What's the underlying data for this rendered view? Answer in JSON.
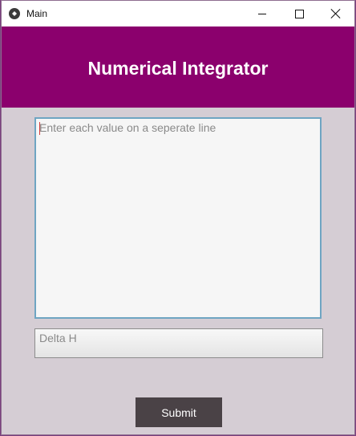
{
  "window": {
    "title": "Main"
  },
  "header": {
    "title": "Numerical Integrator"
  },
  "form": {
    "values_placeholder": "Enter each value on a seperate line",
    "values_value": "",
    "delta_placeholder": "Delta H",
    "delta_value": "",
    "submit_label": "Submit"
  },
  "colors": {
    "header_bg": "#8b006d",
    "body_bg": "#d5cdd4",
    "input_focus_border": "#6fa5c2",
    "button_bg": "#4a4246"
  },
  "icons": [
    "kivy-app-icon",
    "minimize-icon",
    "maximize-icon",
    "close-icon"
  ]
}
